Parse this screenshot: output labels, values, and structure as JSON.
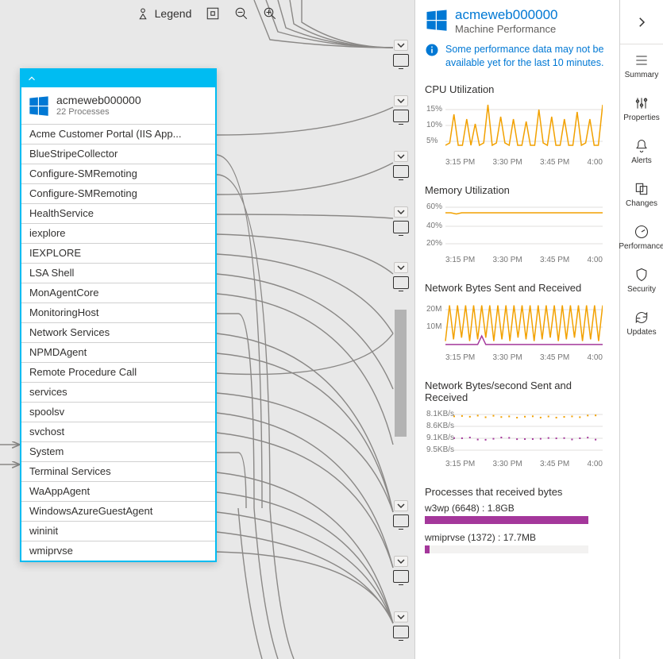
{
  "toolbar": {
    "legend_label": "Legend"
  },
  "machine_card": {
    "name": "acmeweb000000",
    "subtitle": "22 Processes",
    "processes": [
      "Acme Customer Portal (IIS App...",
      "BlueStripeCollector",
      "Configure-SMRemoting",
      "Configure-SMRemoting",
      "HealthService",
      "iexplore",
      "IEXPLORE",
      "LSA Shell",
      "MonAgentCore",
      "MonitoringHost",
      "Network Services",
      "NPMDAgent",
      "Remote Procedure Call",
      "services",
      "spoolsv",
      "svchost",
      "System",
      "Terminal Services",
      "WaAppAgent",
      "WindowsAzureGuestAgent",
      "wininit",
      "wmiprvse"
    ]
  },
  "panel": {
    "title": "acmeweb000000",
    "subtitle": "Machine Performance",
    "info_message": "Some performance data may not be available yet for the last 10 minutes.",
    "x_ticks": [
      "3:15 PM",
      "3:30 PM",
      "3:45 PM",
      "4:00"
    ],
    "charts": {
      "cpu": {
        "title": "CPU Utilization",
        "y_labels": [
          "15%",
          "10%",
          "5%"
        ]
      },
      "mem": {
        "title": "Memory Utilization",
        "y_labels": [
          "60%",
          "40%",
          "20%"
        ]
      },
      "bytes": {
        "title": "Network Bytes Sent and Received",
        "y_labels": [
          "20M",
          "10M"
        ]
      },
      "bps": {
        "title": "Network Bytes/second Sent and Received",
        "y_labels": [
          "8.1KB/s",
          "8.6KB/s",
          "9.1KB/s",
          "9.5KB/s"
        ]
      }
    },
    "processes_received": {
      "title": "Processes that received bytes",
      "rows": [
        {
          "label": "w3wp (6648) : 1.8GB",
          "pct": 100
        },
        {
          "label": "wmiprvse (1372) : 17.7MB",
          "pct": 3
        }
      ]
    }
  },
  "rail": {
    "items": [
      {
        "label": "Summary",
        "icon": "list-icon"
      },
      {
        "label": "Properties",
        "icon": "sliders-icon"
      },
      {
        "label": "Alerts",
        "icon": "bell-icon"
      },
      {
        "label": "Changes",
        "icon": "diff-icon"
      },
      {
        "label": "Performance",
        "icon": "gauge-icon"
      },
      {
        "label": "Security",
        "icon": "shield-icon"
      },
      {
        "label": "Updates",
        "icon": "refresh-icon"
      }
    ]
  },
  "chart_data": [
    {
      "type": "line",
      "title": "CPU Utilization",
      "xlabel": "",
      "ylabel": "",
      "ylim": [
        0,
        20
      ],
      "x_ticks": [
        "3:15 PM",
        "3:30 PM",
        "3:45 PM",
        "4:00"
      ],
      "series": [
        {
          "name": "cpu",
          "color": "#f2a100",
          "values": [
            3,
            4,
            16,
            3,
            3,
            14,
            3,
            12,
            3,
            4,
            20,
            3,
            4,
            15,
            4,
            3,
            14,
            3,
            3,
            13,
            3,
            3,
            18,
            4,
            3,
            15,
            3,
            3,
            14,
            3,
            3,
            17,
            3,
            4,
            14,
            3,
            3,
            20
          ]
        }
      ]
    },
    {
      "type": "line",
      "title": "Memory Utilization",
      "xlabel": "",
      "ylabel": "",
      "ylim": [
        0,
        70
      ],
      "x_ticks": [
        "3:15 PM",
        "3:30 PM",
        "3:45 PM",
        "4:00"
      ],
      "series": [
        {
          "name": "mem",
          "color": "#f2a100",
          "values": [
            60,
            60,
            58,
            60,
            60,
            60,
            60,
            60,
            60,
            60,
            60,
            60,
            60,
            60,
            60,
            60,
            60,
            60,
            60,
            60,
            60,
            60,
            60,
            60,
            60,
            60,
            60,
            60,
            60,
            60
          ]
        }
      ]
    },
    {
      "type": "line",
      "title": "Network Bytes Sent and Received",
      "xlabel": "",
      "ylabel": "",
      "ylim": [
        0,
        25000000
      ],
      "x_ticks": [
        "3:15 PM",
        "3:30 PM",
        "3:45 PM",
        "4:00"
      ],
      "series": [
        {
          "name": "sent",
          "color": "#f2a100",
          "values": [
            3,
            24,
            4,
            24,
            5,
            24,
            3,
            24,
            4,
            24,
            5,
            24,
            3,
            24,
            4,
            24,
            3,
            24,
            5,
            24,
            4,
            24,
            3,
            24,
            4,
            24,
            5,
            24,
            3,
            24,
            4,
            24,
            5,
            24,
            3,
            24,
            4,
            24,
            3,
            24
          ],
          "scale": 1000000
        },
        {
          "name": "received",
          "color": "#a4379b",
          "values": [
            1,
            1,
            1,
            1,
            1,
            1,
            1,
            1,
            1,
            6,
            1,
            1,
            1,
            1,
            1,
            1,
            1,
            1,
            1,
            1,
            1,
            1,
            1,
            1,
            1,
            1,
            1,
            1,
            1,
            1,
            1,
            1,
            1,
            1,
            1,
            1,
            1,
            1,
            1,
            1
          ],
          "scale": 1000000
        }
      ]
    },
    {
      "type": "scatter",
      "title": "Network Bytes/second Sent and Received",
      "xlabel": "",
      "ylabel": "",
      "x_ticks": [
        "3:15 PM",
        "3:30 PM",
        "3:45 PM",
        "4:00"
      ],
      "ylim": [
        8000,
        10000
      ],
      "series": [
        {
          "name": "sent",
          "color": "#f2a100",
          "values": [
            8100,
            8150,
            8100,
            8200,
            8100,
            8150,
            8150,
            8100,
            8200,
            8150,
            8100,
            8100,
            8150,
            8200,
            8100,
            8150,
            8100,
            8100,
            8150,
            8100
          ]
        },
        {
          "name": "received",
          "color": "#a4379b",
          "values": [
            9100,
            9150,
            9120,
            9100,
            9130,
            9110,
            9100,
            9150,
            9120,
            9100,
            9140,
            9110,
            9100,
            9150,
            9120,
            9100,
            9130,
            9110,
            9100,
            9140
          ]
        }
      ]
    },
    {
      "type": "bar",
      "title": "Processes that received bytes",
      "categories": [
        "w3wp (6648)",
        "wmiprvse (1372)"
      ],
      "values": [
        1800,
        17.7
      ],
      "unit": "MB"
    }
  ]
}
